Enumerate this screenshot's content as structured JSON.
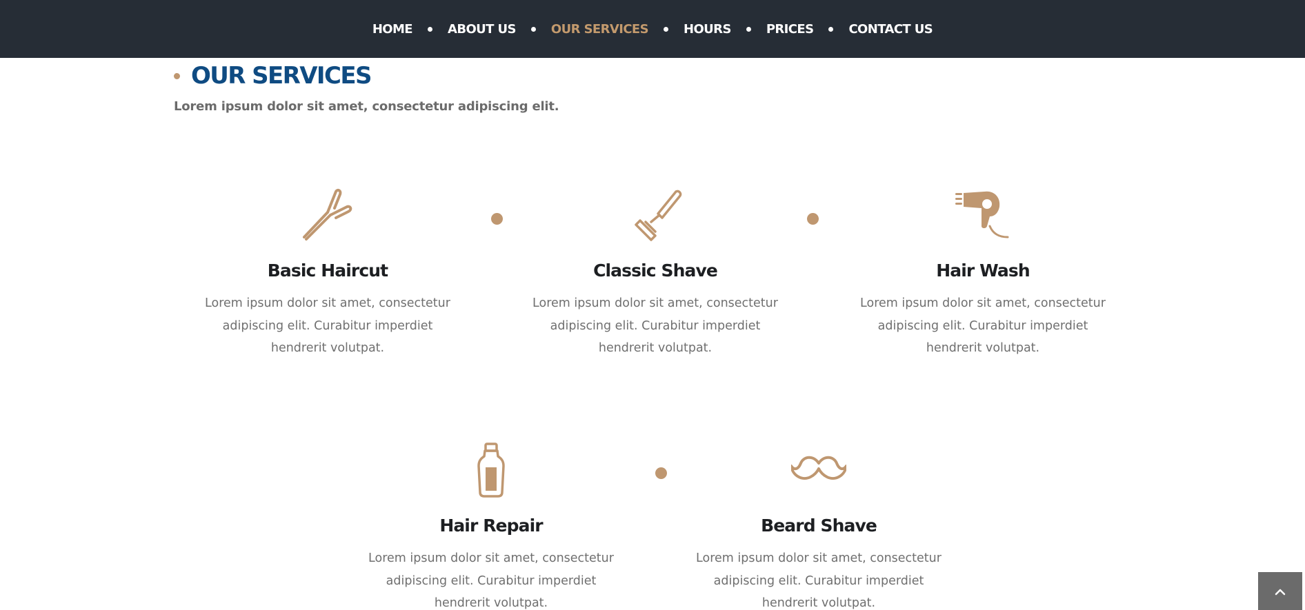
{
  "nav": {
    "items": [
      {
        "label": "HOME"
      },
      {
        "label": "ABOUT US"
      },
      {
        "label": "OUR SERVICES",
        "active": true
      },
      {
        "label": "HOURS"
      },
      {
        "label": "PRICES"
      },
      {
        "label": "CONTACT US"
      }
    ]
  },
  "section": {
    "title": "OUR SERVICES",
    "subtitle": "Lorem ipsum dolor sit amet, consectetur adipiscing elit."
  },
  "services": [
    {
      "icon": "scissors-icon",
      "title": "Basic Haircut",
      "description": "Lorem ipsum dolor sit amet, consectetur adipiscing elit. Curabitur imperdiet hendrerit volutpat."
    },
    {
      "icon": "razor-icon",
      "title": "Classic Shave",
      "description": "Lorem ipsum dolor sit amet, consectetur adipiscing elit. Curabitur imperdiet hendrerit volutpat."
    },
    {
      "icon": "hair-dryer-icon",
      "title": "Hair Wash",
      "description": "Lorem ipsum dolor sit amet, consectetur adipiscing elit. Curabitur imperdiet hendrerit volutpat."
    },
    {
      "icon": "bottle-icon",
      "title": "Hair Repair",
      "description": "Lorem ipsum dolor sit amet, consectetur adipiscing elit. Curabitur imperdiet hendrerit volutpat."
    },
    {
      "icon": "mustache-icon",
      "title": "Beard Shave",
      "description": "Lorem ipsum dolor sit amet, consectetur adipiscing elit. Curabitur imperdiet hendrerit volutpat."
    }
  ],
  "back_to_top": {
    "icon": "chevron-up-icon"
  },
  "colors": {
    "nav_bg": "#262d36",
    "accent": "#c39a6d",
    "heading": "#0f4b82",
    "text": "#6f6f6f"
  }
}
